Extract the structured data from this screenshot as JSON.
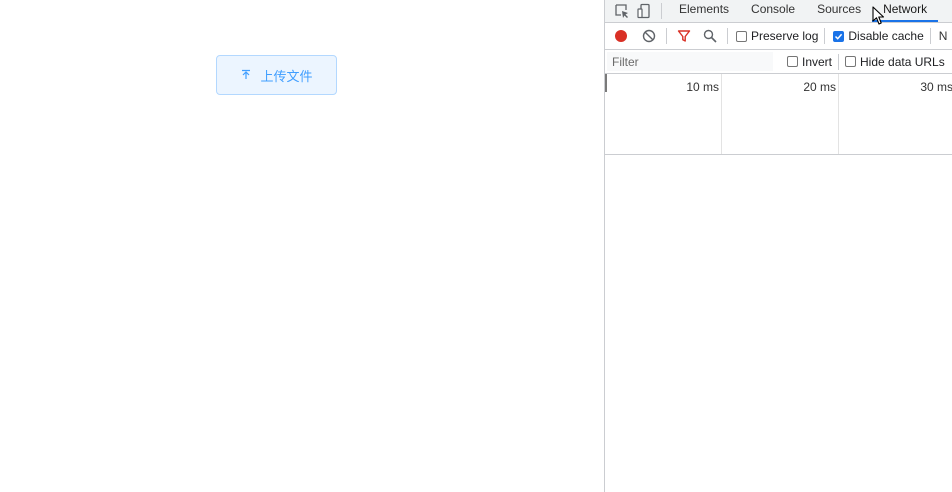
{
  "page": {
    "upload_button_label": "上传文件",
    "accent_color": "#409eff"
  },
  "devtools": {
    "tabs": [
      {
        "label": "Elements",
        "active": false
      },
      {
        "label": "Console",
        "active": false
      },
      {
        "label": "Sources",
        "active": false
      },
      {
        "label": "Network",
        "active": true
      }
    ],
    "tabs_overflow_label": "N",
    "toolbar": {
      "record_icon": "record-icon",
      "clear_icon": "clear-icon",
      "filter_icon": "filter-icon",
      "search_icon": "search-icon",
      "preserve_log": {
        "label": "Preserve log",
        "checked": false
      },
      "disable_cache": {
        "label": "Disable cache",
        "checked": true
      }
    },
    "filter_bar": {
      "placeholder": "Filter",
      "invert": {
        "label": "Invert",
        "checked": false
      },
      "hide_data_urls": {
        "label": "Hide data URLs",
        "checked": false
      }
    },
    "overview": {
      "ticks": [
        "10 ms",
        "20 ms",
        "30 ms"
      ]
    },
    "colors": {
      "record": "#d93025",
      "filter": "#d93025",
      "active_tab": "#1a73e8"
    }
  }
}
